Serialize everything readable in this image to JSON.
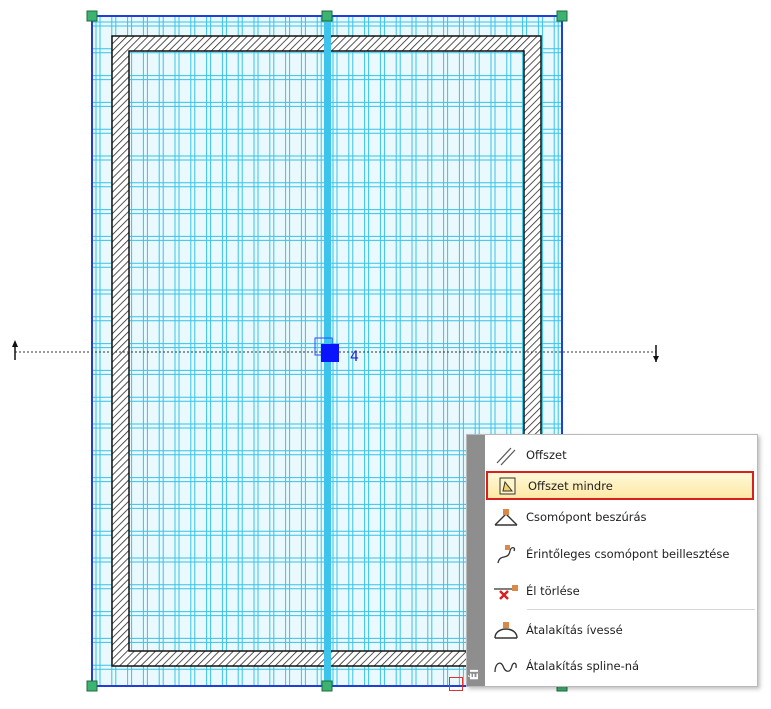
{
  "canvas": {
    "node_label": "4",
    "colors": {
      "grid_line": "#36c3e8",
      "frame": "#1f3fd8",
      "handle": "#3cb371",
      "selected_node": "#0a14ff",
      "hatch": "#2a2a2a"
    }
  },
  "context_menu": {
    "side_label": "Él",
    "items": [
      {
        "label": "Offszet",
        "icon": "offset-line-icon"
      },
      {
        "label": "Offszet mindre",
        "icon": "offset-all-icon",
        "highlighted": true
      },
      {
        "label": "Csomópont beszúrás",
        "icon": "insert-node-icon"
      },
      {
        "label": "Érintőleges csomópont beillesztése",
        "icon": "tangent-node-icon"
      },
      {
        "label": "Él törlése",
        "icon": "delete-edge-icon"
      },
      {
        "label": "Átalakítás ívessé",
        "icon": "convert-arc-icon"
      },
      {
        "label": "Átalakítás spline-ná",
        "icon": "convert-spline-icon"
      }
    ]
  }
}
